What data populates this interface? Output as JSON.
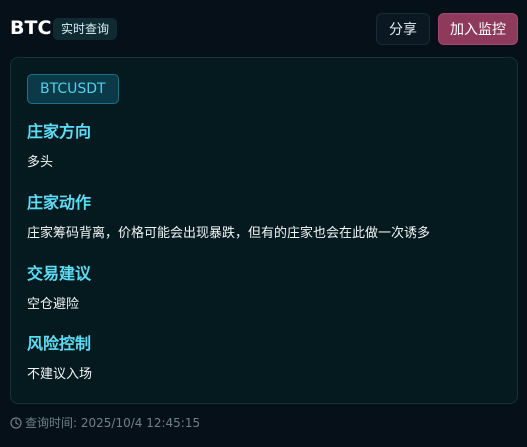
{
  "header": {
    "title": "BTC",
    "badge": "实时查询",
    "share_label": "分享",
    "monitor_label": "加入监控"
  },
  "card": {
    "symbol": "BTCUSDT",
    "sections": [
      {
        "title": "庄家方向",
        "text": "多头"
      },
      {
        "title": "庄家动作",
        "text": "庄家筹码背离，价格可能会出现暴跌，但有的庄家也会在此做一次诱多"
      },
      {
        "title": "交易建议",
        "text": "空仓避险"
      },
      {
        "title": "风险控制",
        "text": "不建议入场"
      }
    ]
  },
  "footer": {
    "query_time_label": "查询时间: 2025/10/4 12:45:15",
    "icon": "clock-icon"
  },
  "colors": {
    "background": "#061018",
    "card_background": "#051a1f",
    "section_title": "#5ddcf5",
    "monitor_button": "#8d3a5c"
  }
}
